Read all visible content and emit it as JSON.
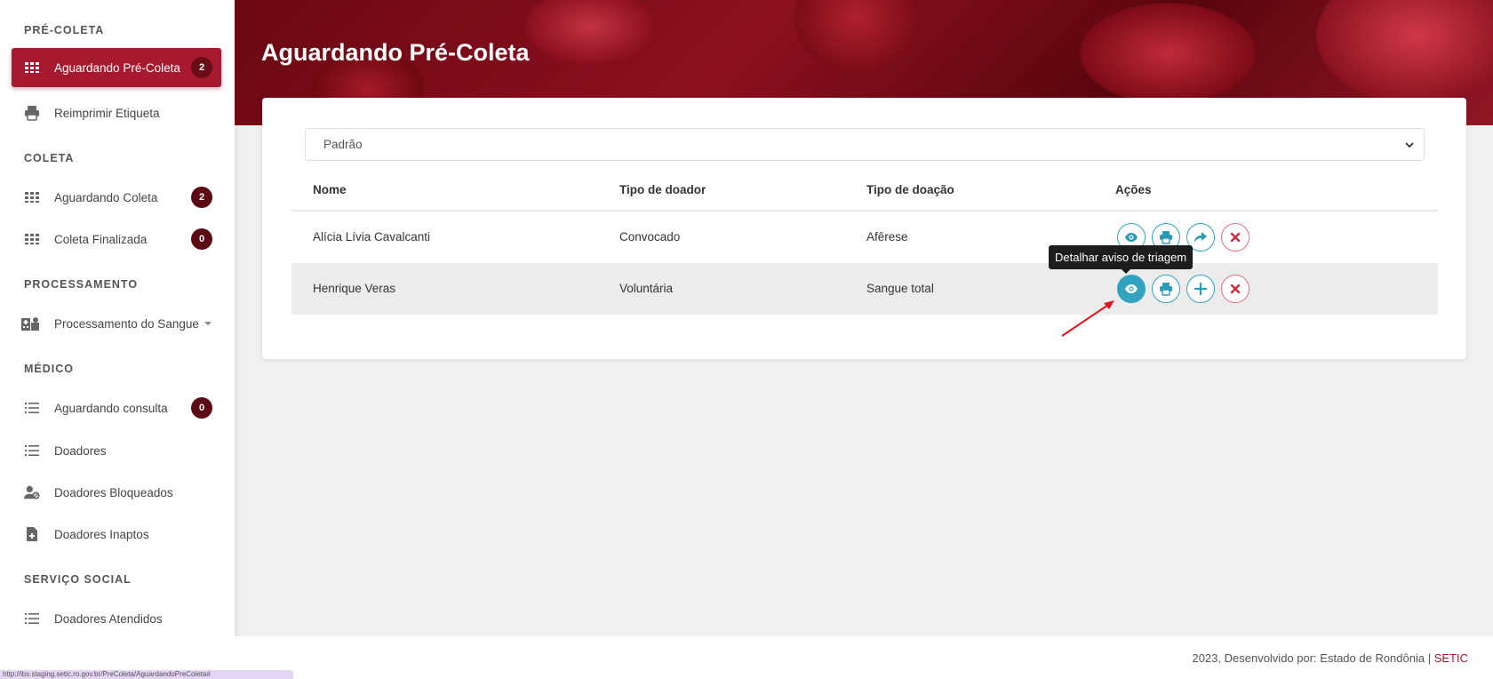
{
  "sidebar": {
    "sections": {
      "pre_coleta": "PRÉ-COLETA",
      "coleta": "COLETA",
      "processamento": "PROCESSAMENTO",
      "medico": "MÉDICO",
      "servico_social": "SERVIÇO SOCIAL"
    },
    "items": {
      "aguardando_pre_coleta": {
        "label": "Aguardando Pré-Coleta",
        "badge": "2",
        "icon": "grid-icon"
      },
      "reimprimir_etiqueta": {
        "label": "Reimprimir Etiqueta",
        "icon": "printer-icon"
      },
      "aguardando_coleta": {
        "label": "Aguardando Coleta",
        "badge": "2",
        "icon": "grid-icon"
      },
      "coleta_finalizada": {
        "label": "Coleta Finalizada",
        "badge": "0",
        "icon": "grid-icon"
      },
      "processamento_sangue": {
        "label": "Processamento do Sangue",
        "icon": "hospital-icon"
      },
      "aguardando_consulta": {
        "label": "Aguardando consulta",
        "badge": "0",
        "icon": "list-icon"
      },
      "doadores": {
        "label": "Doadores",
        "icon": "list-icon"
      },
      "doadores_bloqueados": {
        "label": "Doadores Bloqueados",
        "icon": "user-block-icon"
      },
      "doadores_inaptos": {
        "label": "Doadores Inaptos",
        "icon": "file-medical-icon"
      },
      "doadores_atendidos": {
        "label": "Doadores Atendidos",
        "icon": "list-icon"
      }
    }
  },
  "statusbar": {
    "url": "http://ibs.staging.setic.ro.gov.br/PreColeta/AguardandoPreColeta#"
  },
  "main": {
    "title": "Aguardando Pré-Coleta",
    "filter": {
      "selected": "Padrão"
    },
    "table": {
      "headers": {
        "nome": "Nome",
        "tipo_doador": "Tipo de doador",
        "tipo_doacao": "Tipo de doação",
        "acoes": "Ações"
      },
      "rows": [
        {
          "nome": "Alícia Lívia Cavalcanti",
          "tipo_doador": "Convocado",
          "tipo_doacao": "Afêrese"
        },
        {
          "nome": "Henrique Veras",
          "tipo_doador": "Voluntária",
          "tipo_doacao": "Sangue total"
        }
      ]
    },
    "tooltip": "Detalhar aviso de triagem"
  },
  "footer": {
    "text": "2023, Desenvolvido por: Estado de Rondônia | ",
    "brand": "SETIC"
  },
  "colors": {
    "accent": "#a6192e",
    "badge": "#5c0a14",
    "action": "#31a3c0",
    "danger": "#d0283a"
  }
}
